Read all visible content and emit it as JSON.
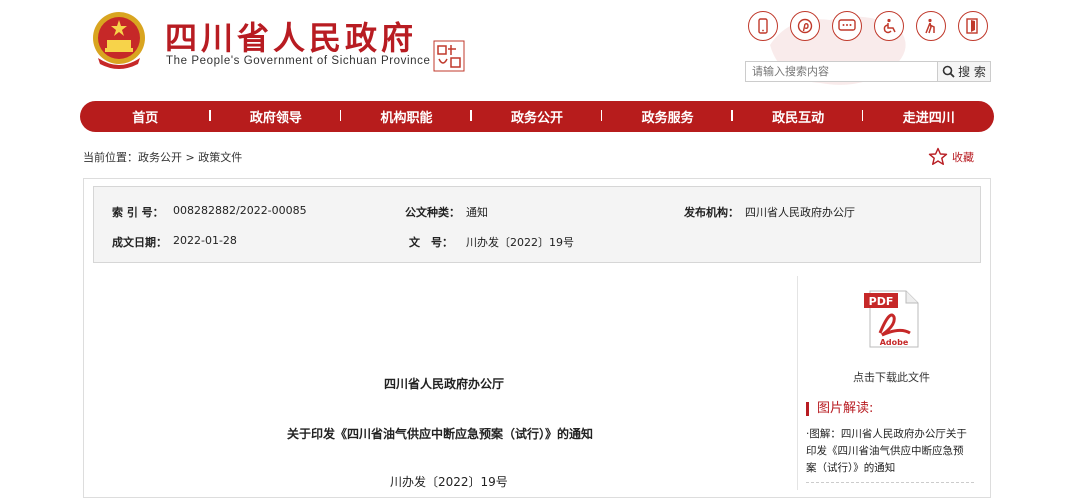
{
  "header": {
    "title": "四川省人民政府",
    "subtitle": "The People's Government of Sichuan Province"
  },
  "top_icons": [
    "mobile-icon",
    "pinterest-icon",
    "chat-icon",
    "accessibility-icon",
    "elderly-icon",
    "exit-icon"
  ],
  "search": {
    "placeholder": "请输入搜索内容",
    "button_label": "搜 索"
  },
  "nav": {
    "items": [
      "首页",
      "政府领导",
      "机构职能",
      "政务公开",
      "政务服务",
      "政民互动",
      "走进四川"
    ]
  },
  "breadcrumb": "当前位置：政务公开 > 政策文件",
  "collect_label": "收藏",
  "meta": {
    "index_label": "索 引 号：",
    "index_value": "008282882/2022-00085",
    "type_label": "公文种类：",
    "type_value": "通知",
    "publisher_label": "发布机构：",
    "publisher_value": "四川省人民政府办公厅",
    "date_label": "成文日期：",
    "date_value": "2022-01-28",
    "docno_label": "文　号：",
    "docno_value": "川办发〔2022〕19号"
  },
  "document": {
    "org": "四川省人民政府办公厅",
    "title": "关于印发《四川省油气供应中断应急预案（试行）》的通知",
    "number": "川办发〔2022〕19号"
  },
  "sidebar": {
    "pdf_label_top": "PDF",
    "pdf_label_bottom": "Adobe",
    "download_text": "点击下载此文件",
    "pic_heading": "图片解读:",
    "pic_item": "·图解：四川省人民政府办公厅关于印发《四川省油气供应中断应急预案（试行）》的通知"
  },
  "colors": {
    "brand_red": "#b81c22",
    "nav_red": "#b71c1c"
  }
}
